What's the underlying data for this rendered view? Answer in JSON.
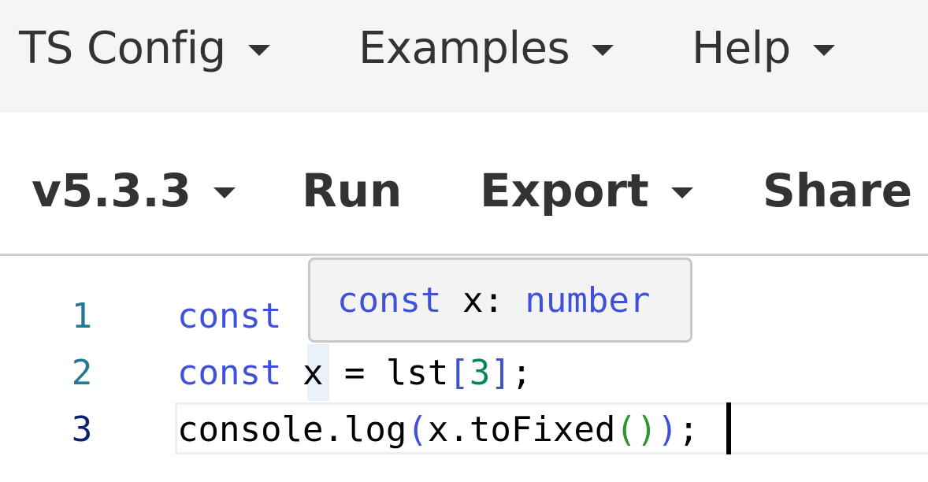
{
  "menubar": {
    "items": [
      {
        "label": "TS Config"
      },
      {
        "label": "Examples"
      },
      {
        "label": "Help"
      }
    ]
  },
  "toolbar": {
    "version_label": "v5.3.3",
    "run_label": "Run",
    "export_label": "Export",
    "share_label": "Share"
  },
  "editor": {
    "line_numbers": [
      "1",
      "2",
      "3"
    ],
    "line1": {
      "keyword": "const"
    },
    "line2": {
      "keyword": "const",
      "ident": " x = lst",
      "open": "[",
      "num": "3",
      "close": "]",
      "end": ";"
    },
    "line3": {
      "obj": "console.log",
      "open": "(",
      "arg": "x.toFixed",
      "inner": "()",
      "close": ")",
      "end": ";"
    }
  },
  "hover_tooltip": {
    "keyword": "const",
    "name": " x: ",
    "type": "number"
  },
  "colors": {
    "keyword": "#3f51d8",
    "bracket_level1": "#3f51d8",
    "bracket_level2": "#319331",
    "number_literal": "#098658",
    "line_number": "#237893"
  }
}
